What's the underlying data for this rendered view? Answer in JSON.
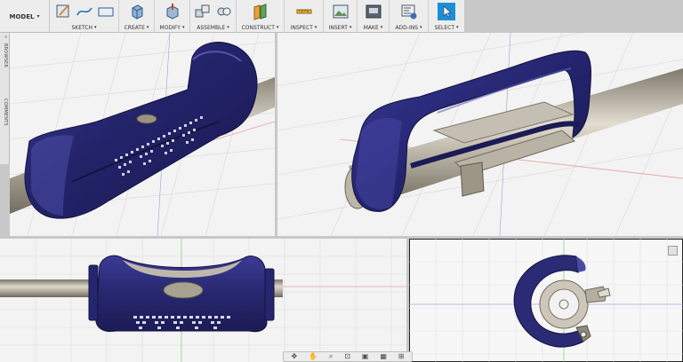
{
  "workspace": {
    "mode": "MODEL"
  },
  "toolbar": {
    "groups": [
      {
        "id": "sketch",
        "label": "SKETCH"
      },
      {
        "id": "create",
        "label": "CREATE"
      },
      {
        "id": "modify",
        "label": "MODIFY"
      },
      {
        "id": "assemble",
        "label": "ASSEMBLE"
      },
      {
        "id": "construct",
        "label": "CONSTRUCT"
      },
      {
        "id": "inspect",
        "label": "INSPECT"
      },
      {
        "id": "insert",
        "label": "INSERT"
      },
      {
        "id": "make",
        "label": "MAKE"
      },
      {
        "id": "addins",
        "label": "ADD-INS"
      },
      {
        "id": "select",
        "label": "SELECT"
      }
    ],
    "caret": "▾"
  },
  "sidebar": {
    "browser_label": "BROWSER",
    "comments_label": "COMMENTS",
    "expand_glyph": "»"
  },
  "colors": {
    "part_blue": "#2c2c78",
    "part_highlight": "#5c5cae",
    "shaft": "#b7b2a4",
    "grid": "#d4d4d4",
    "axis_red": "#e07f7f",
    "axis_green": "#7fc27f",
    "select_active": "#1e8fd6"
  },
  "navbar": {
    "icons": [
      "orbit-icon",
      "pan-icon",
      "zoom-icon",
      "fit-icon",
      "display-icon",
      "grid-icon",
      "viewports-icon"
    ]
  }
}
